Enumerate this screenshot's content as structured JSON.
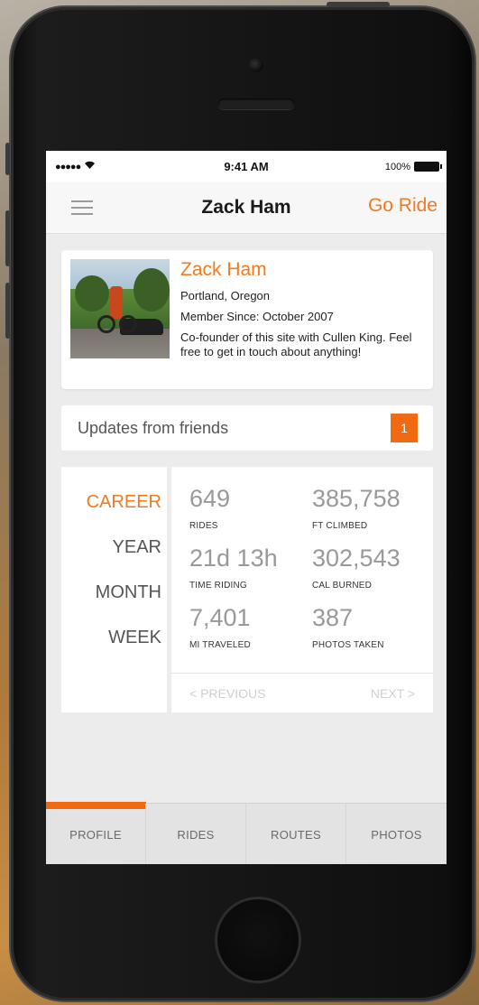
{
  "status_bar": {
    "signal": "●●●●●",
    "wifi": "📶",
    "time": "9:41 AM",
    "battery_pct": "100%",
    "icons": [
      "signal-dots-icon",
      "wifi-icon",
      "battery-icon"
    ]
  },
  "nav": {
    "title": "Zack Ham",
    "go_ride": "Go Ride",
    "menu_icon": "hamburger-icon"
  },
  "profile": {
    "name": "Zack Ham",
    "location": "Portland, Oregon",
    "member_since": "Member Since: October 2007",
    "bio": "Co-founder of this site with Cullen King. Feel free to get in touch about anything!"
  },
  "updates": {
    "label": "Updates from friends",
    "count": "1"
  },
  "periods": [
    "CAREER",
    "YEAR",
    "MONTH",
    "WEEK"
  ],
  "active_period": "CAREER",
  "stats": [
    {
      "value": "649",
      "label": "RIDES"
    },
    {
      "value": "385,758",
      "label": "FT CLIMBED"
    },
    {
      "value": "21d 13h",
      "label": "TIME RIDING"
    },
    {
      "value": "302,543",
      "label": "CAL BURNED"
    },
    {
      "value": "7,401",
      "label": "MI TRAVELED"
    },
    {
      "value": "387",
      "label": "PHOTOS TAKEN"
    }
  ],
  "pager": {
    "prev": "< PREVIOUS",
    "next": "NEXT >"
  },
  "tabs": [
    "PROFILE",
    "RIDES",
    "ROUTES",
    "PHOTOS"
  ],
  "active_tab": "PROFILE",
  "colors": {
    "accent": "#f07a1f",
    "badge": "#f06a14",
    "text_dark": "#1a1a1a",
    "stat_value": "#999999"
  }
}
